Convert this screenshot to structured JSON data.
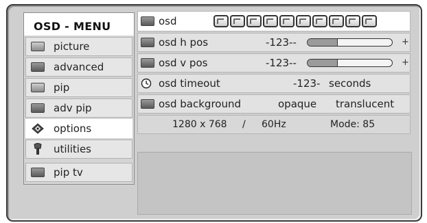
{
  "menu": {
    "title": "OSD - MENU",
    "items": [
      {
        "label": "picture",
        "icon": "picture-icon",
        "active": false
      },
      {
        "label": "advanced",
        "icon": "advanced-icon",
        "active": false
      },
      {
        "label": "pip",
        "icon": "pip-icon",
        "active": false
      },
      {
        "label": "adv pip",
        "icon": "adv-pip-icon",
        "active": false
      },
      {
        "label": "options",
        "icon": "options-icon",
        "active": true
      },
      {
        "label": "utilities",
        "icon": "utilities-icon",
        "active": false
      },
      {
        "label": "pip tv",
        "icon": "pip-tv-icon",
        "active": false
      }
    ]
  },
  "osd": {
    "header_label": "osd",
    "language_tile_count": 10,
    "h_pos": {
      "label": "osd h pos",
      "value": "-123--",
      "plus": "+",
      "level": 0.35
    },
    "v_pos": {
      "label": "osd v pos",
      "value": "-123--",
      "plus": "+",
      "level": 0.35
    },
    "timeout": {
      "label": "osd timeout",
      "value": "-123-",
      "unit": "seconds"
    },
    "background": {
      "label": "osd background",
      "option_1": "opaque",
      "option_2": "translucent"
    },
    "status": {
      "resolution": "1280 x 768",
      "separator": "/",
      "frequency": "60Hz",
      "mode": "Mode: 85"
    }
  },
  "colors": {
    "frame": "#cfcfcf",
    "active_item": "#ffffff",
    "slider_fill": "#9b9b9b"
  }
}
